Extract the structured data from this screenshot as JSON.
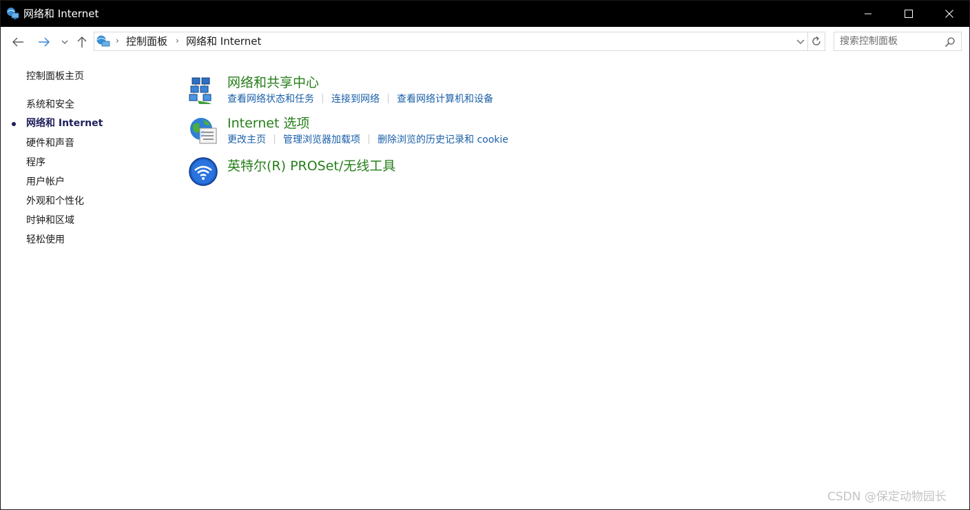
{
  "window": {
    "title": "网络和 Internet"
  },
  "address": {
    "breadcrumbs": [
      "控制面板",
      "网络和 Internet"
    ],
    "search_placeholder": "搜索控制面板"
  },
  "sidebar": {
    "items": [
      {
        "label": "控制面板主页",
        "current": false
      },
      {
        "label": "系统和安全",
        "current": false
      },
      {
        "label": "网络和 Internet",
        "current": true
      },
      {
        "label": "硬件和声音",
        "current": false
      },
      {
        "label": "程序",
        "current": false
      },
      {
        "label": "用户帐户",
        "current": false
      },
      {
        "label": "外观和个性化",
        "current": false
      },
      {
        "label": "时钟和区域",
        "current": false
      },
      {
        "label": "轻松使用",
        "current": false
      }
    ]
  },
  "categories": [
    {
      "title": "网络和共享中心",
      "icon": "network-sharing-center-icon",
      "links": [
        "查看网络状态和任务",
        "连接到网络",
        "查看网络计算机和设备"
      ]
    },
    {
      "title": "Internet 选项",
      "icon": "internet-options-icon",
      "links": [
        "更改主页",
        "管理浏览器加载项",
        "删除浏览的历史记录和 cookie"
      ]
    },
    {
      "title": "英特尔(R) PROSet/无线工具",
      "icon": "intel-wireless-icon",
      "links": []
    }
  ],
  "colors": {
    "category_title": "#267e19",
    "link": "#1a5fa8",
    "titlebar": "#000000",
    "current_nav": "#1e1e5a"
  },
  "watermark": "CSDN @保定动物园长"
}
